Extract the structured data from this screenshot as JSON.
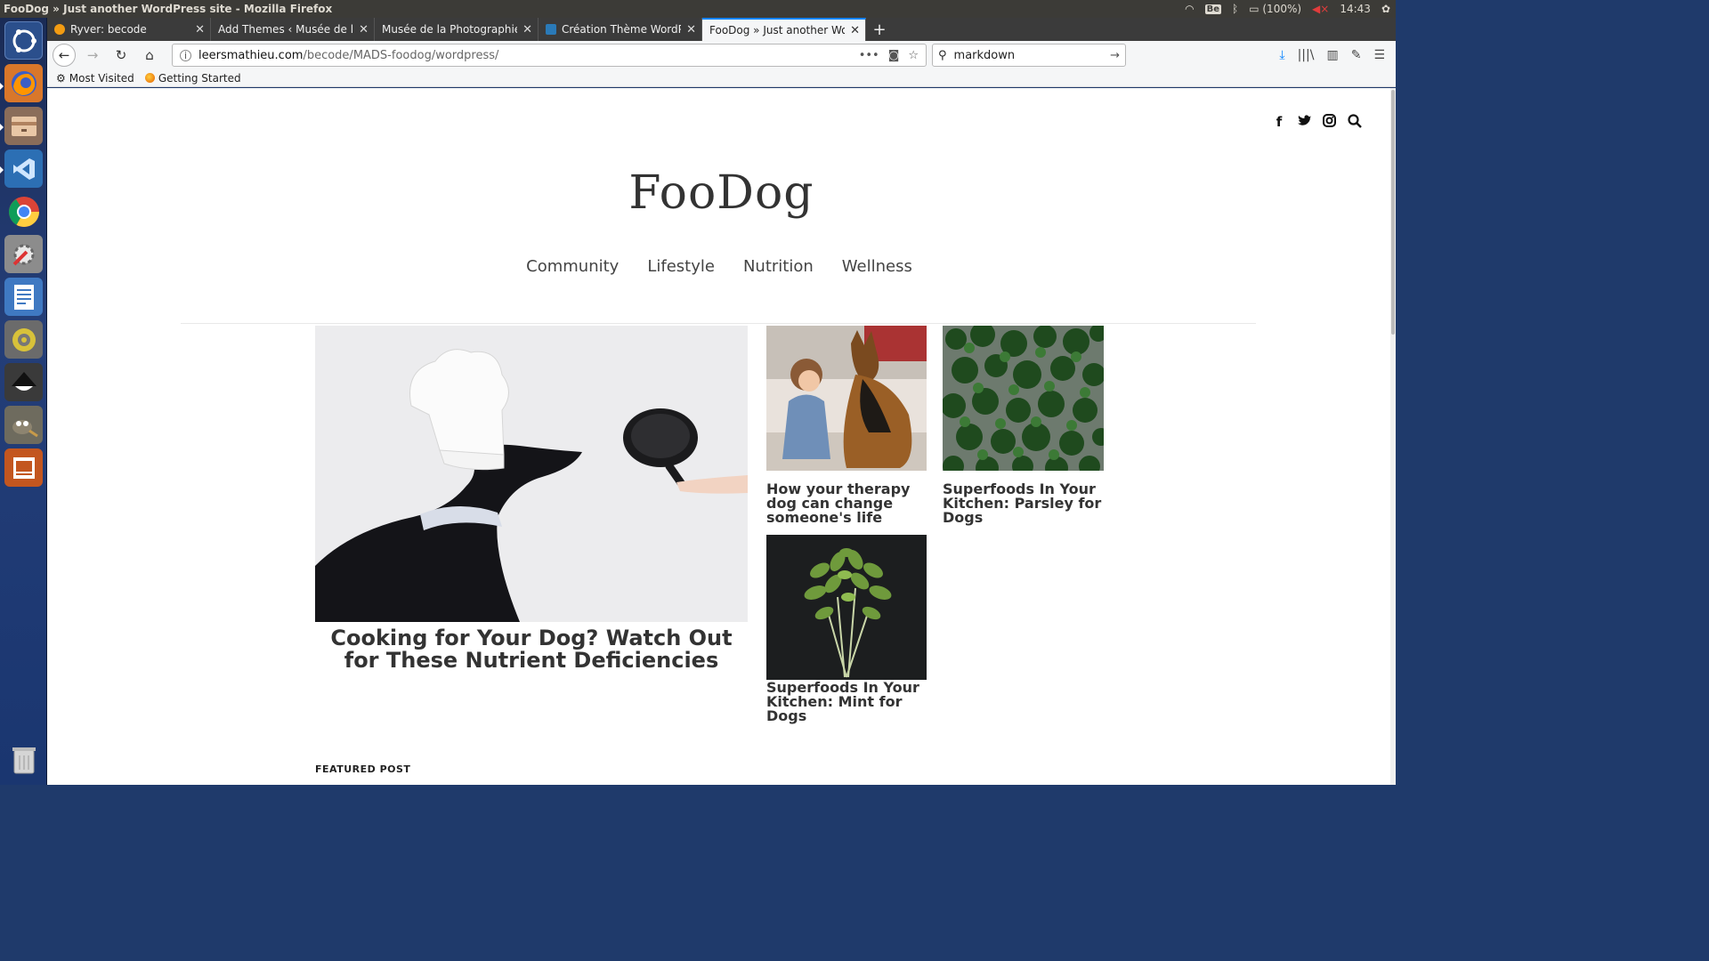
{
  "system": {
    "window_title": "FooDog » Just another WordPress site - Mozilla Firefox",
    "battery": "(100%)",
    "clock": "14:43",
    "indicator_be": "Be"
  },
  "tabs": [
    {
      "label": "Ryver: becode",
      "favicon_color": "#f39c12"
    },
    {
      "label": "Add Themes ‹ Musée de la Ph",
      "favicon_color": ""
    },
    {
      "label": "Musée de la Photographie",
      "favicon_color": ""
    },
    {
      "label": "Création Thème WordPr",
      "favicon_color": "#2a7ab8"
    },
    {
      "label": "FooDog » Just another Wor",
      "favicon_color": "",
      "active": true
    }
  ],
  "urlbar": {
    "host": "leersmathieu.com",
    "path": "/becode/MADS-foodog/wordpress/"
  },
  "searchbar": {
    "value": "markdown"
  },
  "bookmarks": [
    {
      "label": "Most Visited",
      "icon": "gear-icon"
    },
    {
      "label": "Getting Started",
      "icon": "firefox-icon"
    }
  ],
  "site": {
    "title": "FooDog",
    "nav": [
      "Community",
      "Lifestyle",
      "Nutrition",
      "Wellness"
    ],
    "social": [
      "facebook-icon",
      "twitter-icon",
      "instagram-icon",
      "search-icon"
    ],
    "hero": {
      "title": "Cooking for Your Dog? Watch Out for These Nutrient Deficiencies"
    },
    "posts": [
      {
        "title": "How your therapy dog can change someone's life"
      },
      {
        "title": "Superfoods In Your Kitchen: Parsley for Dogs"
      },
      {
        "title": "Superfoods In Your Kitchen: Mint for Dogs"
      }
    ],
    "featured_label": "FEATURED POST"
  },
  "launcher": [
    "ubuntu-dash-icon",
    "firefox-icon",
    "files-icon",
    "vscode-icon",
    "chrome-icon",
    "settings-icon",
    "writer-icon",
    "rhythmbox-icon",
    "inkscape-icon",
    "gimp-icon",
    "impress-icon",
    "trash-icon"
  ]
}
